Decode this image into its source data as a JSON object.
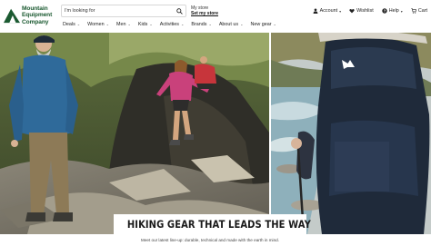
{
  "brand": {
    "name_lines": [
      "Mountain",
      "Equipment",
      "Company"
    ],
    "color": "#1b5a31"
  },
  "search": {
    "placeholder": "I'm looking for",
    "icon": "search-icon"
  },
  "store": {
    "label": "My store",
    "link": "Set my store"
  },
  "utilities": [
    {
      "label": "Account",
      "icon": "user-icon"
    },
    {
      "label": "Wishlist",
      "icon": "heart-icon"
    },
    {
      "label": "Help",
      "icon": "help-icon"
    },
    {
      "label": "Cart",
      "icon": "cart-icon"
    }
  ],
  "nav": [
    {
      "label": "Deals"
    },
    {
      "label": "Women"
    },
    {
      "label": "Men"
    },
    {
      "label": "Kids"
    },
    {
      "label": "Activities"
    },
    {
      "label": "Brands"
    },
    {
      "label": "About us"
    },
    {
      "label": "New gear"
    }
  ],
  "hero": {
    "headline": "HIKING GEAR THAT LEADS THE WAY",
    "subline": "Meet our latest line-up: durable, technical and made with the earth in mind."
  }
}
